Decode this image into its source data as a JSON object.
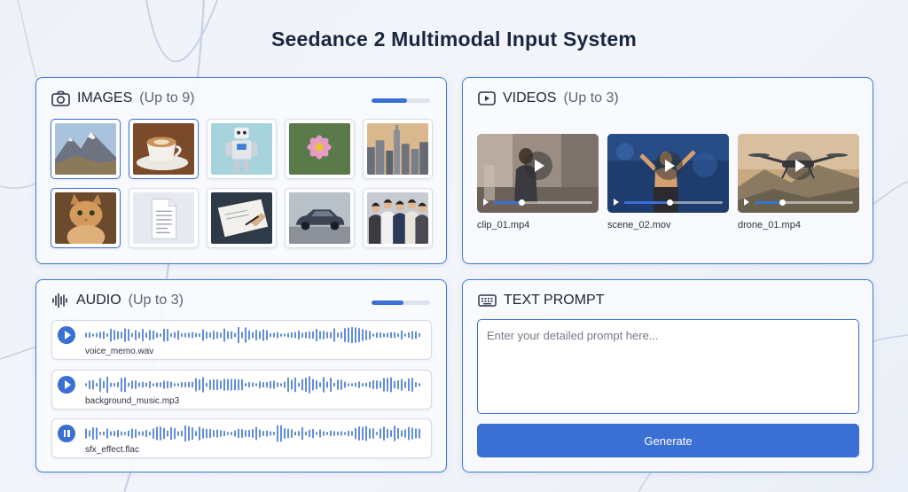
{
  "title": "Seedance 2 Multimodal Input System",
  "images": {
    "label": "IMAGES",
    "limit": "(Up to 9)",
    "progress": 0.6,
    "items": [
      {
        "name": "mountains",
        "selected": true
      },
      {
        "name": "coffee-cup",
        "selected": true
      },
      {
        "name": "robot",
        "selected": false
      },
      {
        "name": "pink-flower",
        "selected": false
      },
      {
        "name": "city-skyline",
        "selected": false
      },
      {
        "name": "cat",
        "selected": true
      },
      {
        "name": "document",
        "selected": false
      },
      {
        "name": "hand-writing",
        "selected": false
      },
      {
        "name": "car",
        "selected": false
      },
      {
        "name": "group-photo",
        "selected": false
      }
    ]
  },
  "videos": {
    "label": "VIDEOS",
    "limit": "(Up to 3)",
    "items": [
      {
        "filename": "clip_01.mp4",
        "progress": 0.28
      },
      {
        "filename": "scene_02.mov",
        "progress": 0.46
      },
      {
        "filename": "drone_01.mp4",
        "progress": 0.28
      }
    ]
  },
  "audio": {
    "label": "AUDIO",
    "limit": "(Up to 3)",
    "progress": 0.55,
    "tracks": [
      {
        "filename": "voice_memo.wav",
        "state": "play"
      },
      {
        "filename": "background_music.mp3",
        "state": "play"
      },
      {
        "filename": "sfx_effect.flac",
        "state": "pause"
      }
    ]
  },
  "text_prompt": {
    "label": "TEXT PROMPT",
    "placeholder": "Enter your detailed prompt here...",
    "value": "",
    "button_label": "Generate"
  },
  "colors": {
    "accent": "#3a6fd4",
    "panel_border": "#3d78d8",
    "title": "#1a2540"
  }
}
